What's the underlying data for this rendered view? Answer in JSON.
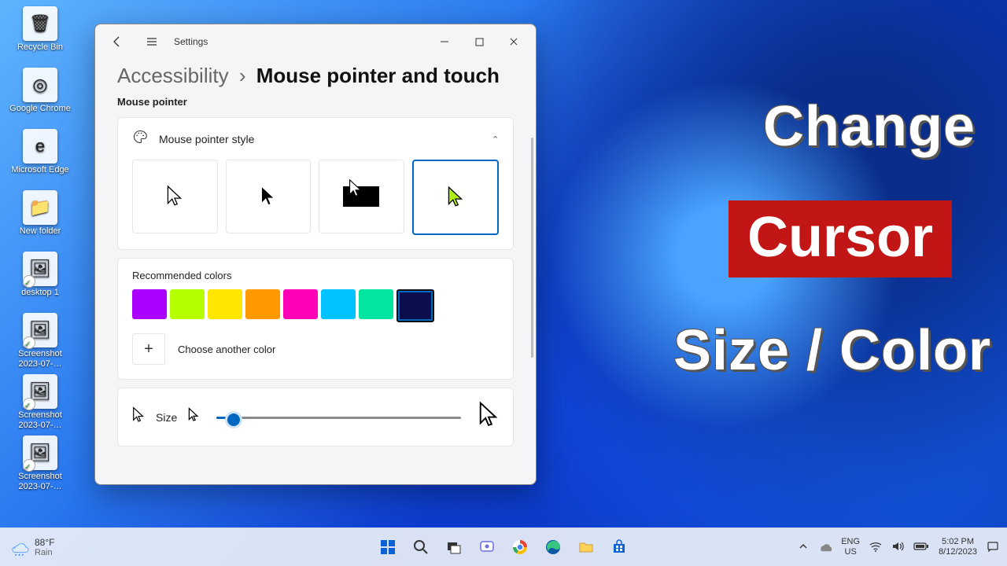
{
  "desktop_icons": [
    {
      "label": "Recycle Bin",
      "glyph": "🗑"
    },
    {
      "label": "Google Chrome",
      "glyph": "◎"
    },
    {
      "label": "Microsoft Edge",
      "glyph": "e"
    },
    {
      "label": "New folder",
      "glyph": "📁"
    },
    {
      "label": "desktop 1",
      "glyph": "🖼",
      "mark": true
    },
    {
      "label": "Screenshot 2023-07-…",
      "glyph": "🖼",
      "mark": true
    },
    {
      "label": "Screenshot 2023-07-…",
      "glyph": "🖼",
      "mark": true
    },
    {
      "label": "Screenshot 2023-07-…",
      "glyph": "🖼",
      "mark": true
    }
  ],
  "overlay": {
    "line1": "Change",
    "line2": "Cursor",
    "line3": "Size / Color"
  },
  "window": {
    "app": "Settings",
    "breadcrumb_parent": "Accessibility",
    "breadcrumb_sep": "›",
    "breadcrumb_current": "Mouse pointer and touch",
    "section": "Mouse pointer",
    "style_label": "Mouse pointer style",
    "rec_label": "Recommended colors",
    "rec_colors": [
      "#a900ff",
      "#b6ff00",
      "#ffe600",
      "#ff9900",
      "#ff00b6",
      "#00c3ff",
      "#00e5a0",
      "#0b0e4a"
    ],
    "rec_selected": 7,
    "choose_label": "Choose another color",
    "size_label": "Size"
  },
  "taskbar": {
    "weather": {
      "temp": "88°F",
      "cond": "Rain"
    },
    "lang1": "ENG",
    "lang2": "US",
    "time": "5:02 PM",
    "date": "8/12/2023"
  }
}
